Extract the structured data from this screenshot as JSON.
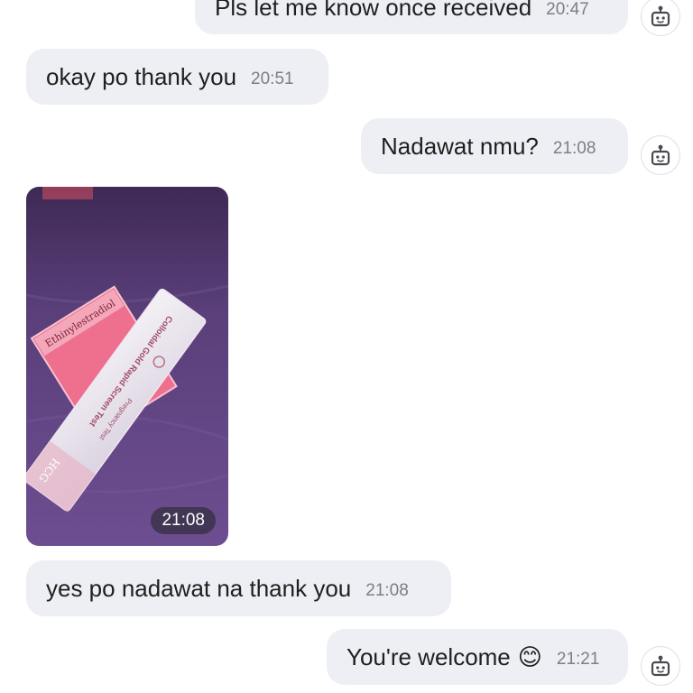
{
  "messages": [
    {
      "text": "Pls let me know once received",
      "time": "20:47",
      "side": "sent"
    },
    {
      "text": "okay po thank you",
      "time": "20:51",
      "side": "received"
    },
    {
      "text": "Nadawat nmu?",
      "time": "21:08",
      "side": "sent"
    },
    {
      "image": {
        "box": {
          "brand": "Ethinylestradiol",
          "rx": "Rx"
        },
        "test_strip": {
          "title": "Colloidal Gold Rapid Screen Test",
          "subtitle": "Pregnancy Test",
          "brand": "HCG"
        }
      },
      "time": "21:08",
      "side": "received"
    },
    {
      "text": "yes po nadawat na thank you",
      "time": "21:08",
      "side": "received"
    },
    {
      "text": "You're welcome",
      "emoji": "😊",
      "time": "21:21",
      "side": "sent"
    }
  ],
  "avatar_icon": "robot-icon",
  "colors": {
    "bubble": "#eeeff4",
    "text": "#1f1f1f",
    "time": "#7d7e85",
    "background": "#ffffff"
  }
}
